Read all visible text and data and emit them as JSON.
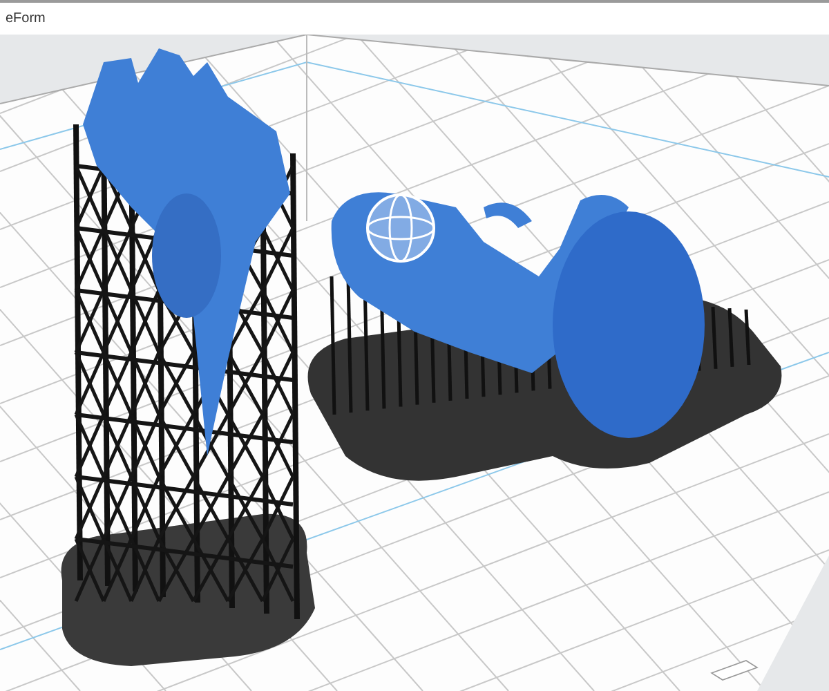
{
  "window": {
    "title": "eForm"
  },
  "viewport": {
    "models": [
      {
        "kind": "tower",
        "selected": false
      },
      {
        "kind": "wide",
        "selected": true
      }
    ]
  }
}
